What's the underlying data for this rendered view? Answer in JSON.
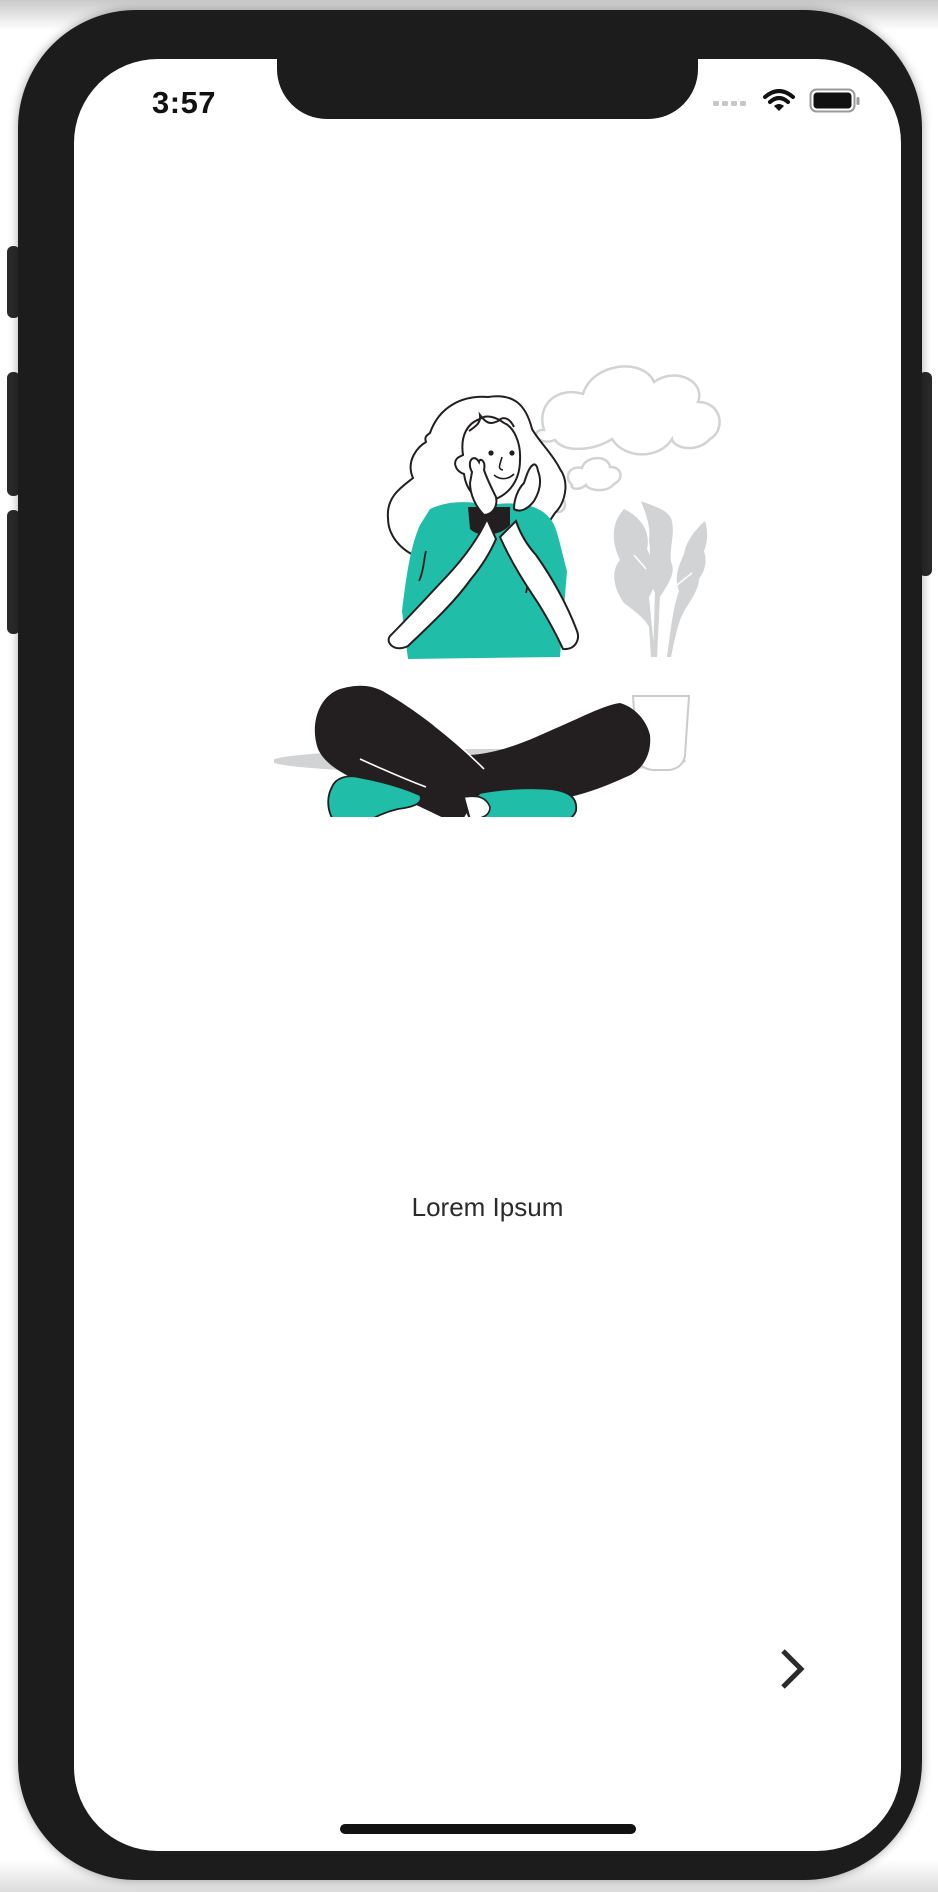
{
  "status_bar": {
    "time": "3:57",
    "signal_icon": "cellular-signal-icon",
    "wifi_icon": "wifi-icon",
    "battery_icon": "battery-icon"
  },
  "onboarding": {
    "illustration": "woman-thinking-illustration",
    "title": "Lorem Ipsum",
    "next_icon": "chevron-right-icon"
  },
  "colors": {
    "accent": "#20bda8",
    "pants": "#231f20",
    "plant": "#d1d3d4",
    "text": "#2b2b2b"
  }
}
